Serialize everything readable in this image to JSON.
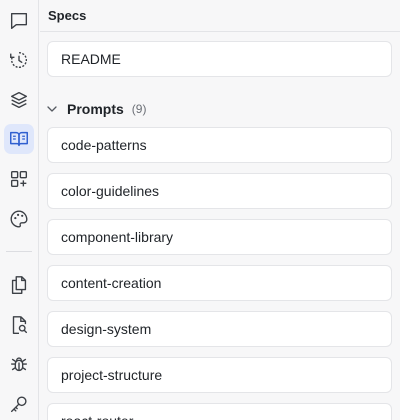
{
  "sidebar": {
    "icons": [
      {
        "name": "chat-icon",
        "active": false
      },
      {
        "name": "history-icon",
        "active": false
      },
      {
        "name": "layers-icon",
        "active": false
      },
      {
        "name": "book-open-icon",
        "active": true
      },
      {
        "name": "add-widget-icon",
        "active": false
      },
      {
        "name": "palette-icon",
        "active": false
      },
      {
        "name": "files-icon",
        "active": false
      },
      {
        "name": "file-search-icon",
        "active": false
      },
      {
        "name": "bug-icon",
        "active": false
      },
      {
        "name": "key-icon",
        "active": false
      }
    ],
    "accent": "#2f5fd0",
    "active_bg": "#dfe7fb"
  },
  "panel": {
    "title": "Specs",
    "readme_label": "README",
    "group": {
      "label": "Prompts",
      "count": "(9)",
      "items": [
        "code-patterns",
        "color-guidelines",
        "component-library",
        "content-creation",
        "design-system",
        "project-structure",
        "react-router"
      ]
    }
  }
}
